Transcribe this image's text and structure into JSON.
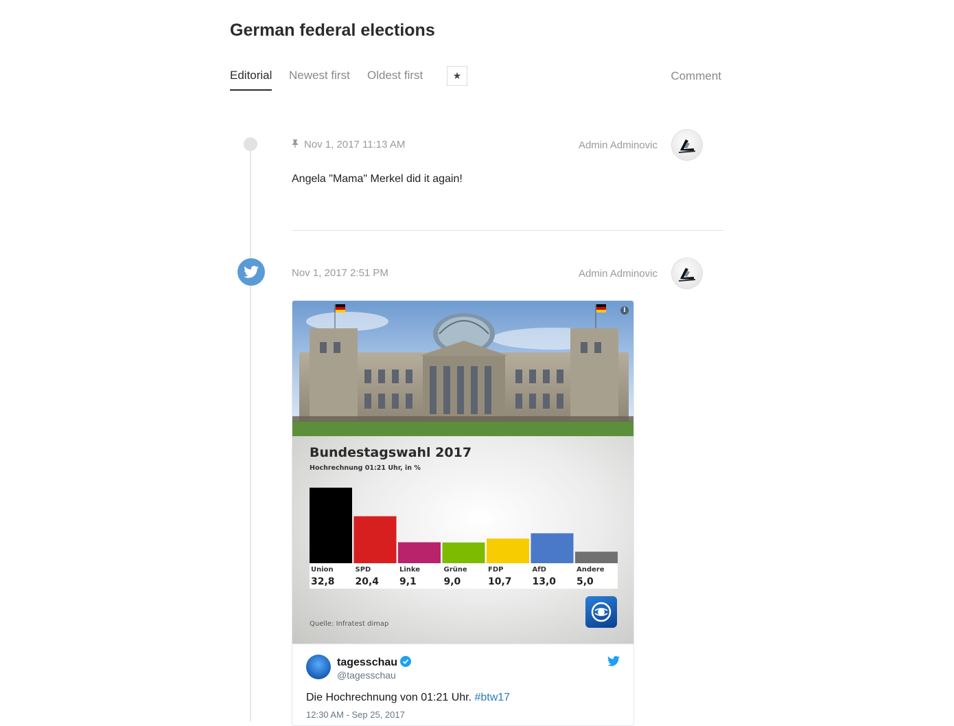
{
  "page": {
    "title": "German federal elections"
  },
  "tabs": [
    {
      "label": "Editorial",
      "active": true
    },
    {
      "label": "Newest first",
      "active": false
    },
    {
      "label": "Oldest first",
      "active": false
    }
  ],
  "toolbar": {
    "star_icon": "star-icon",
    "comment_label": "Comment"
  },
  "posts": [
    {
      "pinned": true,
      "timestamp": "Nov 1, 2017 11:13 AM",
      "author": "Admin Adminovic",
      "text": "Angela \"Mama\" Merkel did it again!"
    },
    {
      "pinned": false,
      "source_icon": "twitter-bird-icon",
      "timestamp": "Nov 1, 2017 2:51 PM",
      "author": "Admin Adminovic",
      "tweet": {
        "name": "tagesschau",
        "handle": "@tagesschau",
        "text": "Die Hochrechnung von 01:21 Uhr. ",
        "hashtag": "#btw17",
        "date": "12:30 AM - Sep 25, 2017"
      }
    }
  ],
  "chart_data": {
    "type": "bar",
    "title": "Bundestagswahl 2017",
    "subtitle": "Hochrechnung 01:21 Uhr, in %",
    "source": "Quelle: Infratest dimap",
    "categories": [
      "Union",
      "SPD",
      "Linke",
      "Grüne",
      "FDP",
      "AfD",
      "Andere"
    ],
    "values": [
      32.8,
      20.4,
      9.1,
      9.0,
      10.7,
      13.0,
      5.0
    ],
    "value_labels": [
      "32,8",
      "20,4",
      "9,1",
      "9,0",
      "10,7",
      "13,0",
      "5,0"
    ],
    "colors": [
      "#000000",
      "#d71f1f",
      "#b8236b",
      "#7cbb00",
      "#f7cc00",
      "#4a79c9",
      "#707070"
    ],
    "xlabel": "",
    "ylabel": "",
    "ylim": [
      0,
      32.8
    ],
    "grid": false,
    "legend": "none"
  },
  "colors": {
    "twitter_blue": "#1da1f2",
    "timeline_twitter": "#5b9bd5"
  }
}
